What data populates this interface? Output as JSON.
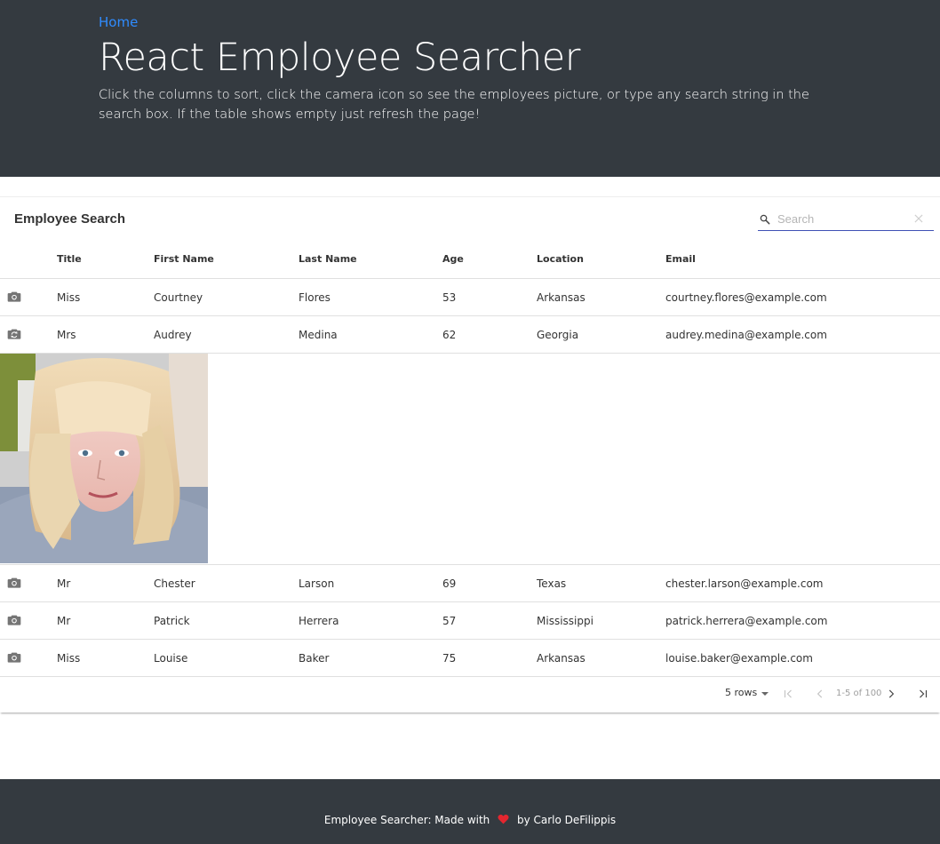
{
  "nav": {
    "home_label": "Home"
  },
  "hero": {
    "title": "React Employee Searcher",
    "description": "Click the columns to sort, click the camera icon so see the employees picture, or type any search string in the search box. If the table shows empty just refresh the page!"
  },
  "table": {
    "title": "Employee Search",
    "search_placeholder": "Search",
    "search_value": "",
    "columns": [
      "Title",
      "First Name",
      "Last Name",
      "Age",
      "Location",
      "Email"
    ],
    "rows": [
      {
        "title": "Miss",
        "first": "Courtney",
        "last": "Flores",
        "age": "53",
        "location": "Arkansas",
        "email": "courtney.flores@example.com",
        "icon": "camera-icon"
      },
      {
        "title": "Mrs",
        "first": "Audrey",
        "last": "Medina",
        "age": "62",
        "location": "Georgia",
        "email": "audrey.medina@example.com",
        "icon": "switch-camera-icon",
        "expanded": true
      },
      {
        "title": "Mr",
        "first": "Chester",
        "last": "Larson",
        "age": "69",
        "location": "Texas",
        "email": "chester.larson@example.com",
        "icon": "camera-icon"
      },
      {
        "title": "Mr",
        "first": "Patrick",
        "last": "Herrera",
        "age": "57",
        "location": "Mississippi",
        "email": "patrick.herrera@example.com",
        "icon": "camera-icon"
      },
      {
        "title": "Miss",
        "first": "Louise",
        "last": "Baker",
        "age": "75",
        "location": "Arkansas",
        "email": "louise.baker@example.com",
        "icon": "camera-icon"
      }
    ],
    "pagination": {
      "rows_per_page": "5 rows",
      "range": "1-5 of 100"
    }
  },
  "footer": {
    "prefix": "Employee Searcher: Made with",
    "suffix": "by Carlo DeFilippis",
    "heart_color": "#e3262f"
  },
  "colors": {
    "header_bg": "#343a40",
    "link": "#2f8cff",
    "search_underline": "#3f51b5"
  }
}
